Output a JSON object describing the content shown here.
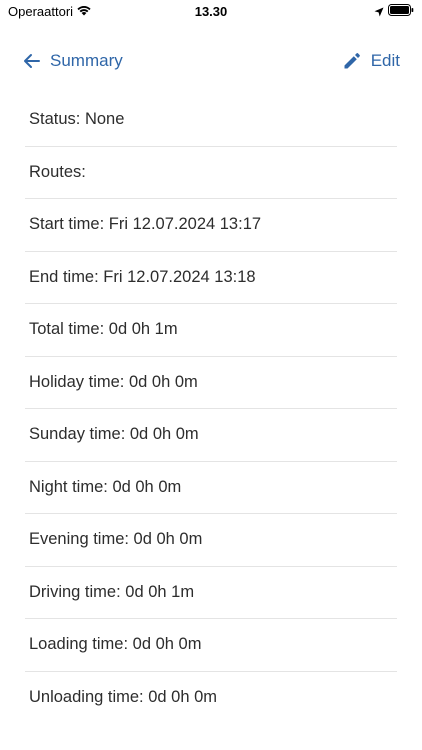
{
  "status_bar": {
    "carrier": "Operaattori",
    "time": "13.30"
  },
  "nav": {
    "back_label": "Summary",
    "edit_label": "Edit"
  },
  "details": [
    {
      "label": "Status: None"
    },
    {
      "label": "Routes:"
    },
    {
      "label": "Start time: Fri 12.07.2024 13:17"
    },
    {
      "label": "End time: Fri 12.07.2024 13:18"
    },
    {
      "label": "Total time: 0d 0h 1m"
    },
    {
      "label": "Holiday time: 0d 0h 0m"
    },
    {
      "label": "Sunday time: 0d 0h 0m"
    },
    {
      "label": "Night time: 0d 0h 0m"
    },
    {
      "label": "Evening time: 0d 0h 0m"
    },
    {
      "label": "Driving time: 0d 0h 1m"
    },
    {
      "label": "Loading time: 0d 0h 0m"
    },
    {
      "label": "Unloading time: 0d 0h 0m"
    }
  ],
  "colors": {
    "accent": "#2f66a8",
    "divider": "#e4e4e4"
  }
}
